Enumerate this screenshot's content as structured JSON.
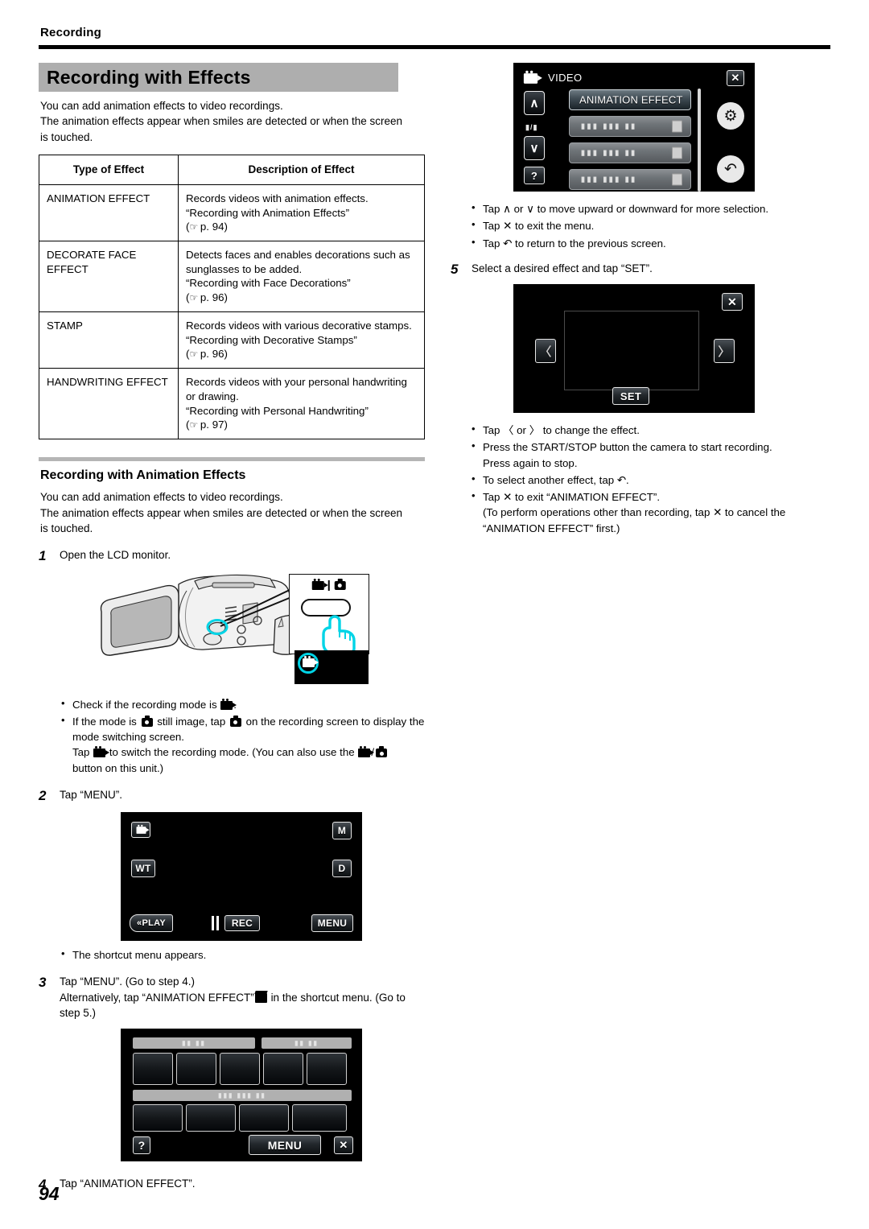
{
  "header": {
    "running_head": "Recording"
  },
  "section": {
    "title": "Recording with Effects",
    "intro_line1": "You can add animation effects to video recordings.",
    "intro_line2": "The animation effects appear when smiles are detected or when the screen",
    "intro_line3": "is touched."
  },
  "table": {
    "columns": [
      "Type of Effect",
      "Description of Effect"
    ],
    "rows": [
      {
        "type": "ANIMATION EFFECT",
        "desc_line1": "Records videos with animation effects.",
        "desc_line2": "“Recording with Animation Effects”",
        "ref": "p. 94"
      },
      {
        "type": "DECORATE FACE EFFECT",
        "desc_line1": "Detects faces and enables decorations such as sunglasses to be added.",
        "desc_line2": "“Recording with Face Decorations”",
        "ref": "p. 96"
      },
      {
        "type": "STAMP",
        "desc_line1": "Records videos with various decorative stamps.",
        "desc_line2": "“Recording with Decorative Stamps”",
        "ref": "p. 96"
      },
      {
        "type": "HANDWRITING EFFECT",
        "desc_line1": "Records videos with your personal handwriting or drawing.",
        "desc_line2": "“Recording with Personal Handwriting”",
        "ref": "p. 97"
      }
    ]
  },
  "subsection": {
    "heading": "Recording with Animation Effects",
    "intro_line1": "You can add animation effects to video recordings.",
    "intro_line2": "The animation effects appear when smiles are detected or when the screen",
    "intro_line3": "is touched."
  },
  "steps": {
    "s1": {
      "num": "1",
      "text": "Open the LCD monitor."
    },
    "s1_bullets": {
      "b1_pre": "Check if the recording mode is",
      "b1_post": ".",
      "b2_pre": "If the mode is",
      "b2_mid1": "still image, tap",
      "b2_mid2": "on the recording screen to display the mode switching screen.",
      "b2_line2_pre": "Tap",
      "b2_line2_mid": "to switch the recording mode. (You can also use the",
      "b2_line2_sep": "/",
      "b2_line2_post": "button on this unit.)"
    },
    "s2": {
      "num": "2",
      "text": "Tap “MENU”."
    },
    "s2_bullet": "The shortcut menu appears.",
    "s3": {
      "num": "3",
      "line1": "Tap “MENU”. (Go to step 4.)",
      "line2_pre": "Alternatively, tap “ANIMATION EFFECT”",
      "line2_post": "in the shortcut menu. (Go to step 5.)"
    },
    "s4": {
      "num": "4",
      "text": "Tap “ANIMATION EFFECT”."
    },
    "s5": {
      "num": "5",
      "text": "Select a desired effect and tap “SET”."
    }
  },
  "right_bullets_top": {
    "b1_pre": "Tap",
    "b1_up": "∧",
    "b1_or": "or",
    "b1_down": "∨",
    "b1_post": "to move upward or downward for more selection.",
    "b2_pre": "Tap",
    "b2_x": "✕",
    "b2_post": "to exit the menu.",
    "b3_pre": "Tap",
    "b3_back": "↶",
    "b3_post": "to return to the previous screen."
  },
  "right_bullets_bottom": {
    "b1_pre": "Tap",
    "b1_left": "〈",
    "b1_or": "or",
    "b1_right": "〉",
    "b1_post": "to change the effect.",
    "b2_line1": "Press the START/STOP button the camera to start recording.",
    "b2_line2": "Press again to stop.",
    "b3_pre": "To select another effect, tap",
    "b3_back": "↶",
    "b3_post": ".",
    "b4_pre": "Tap",
    "b4_x": "✕",
    "b4_post": "to exit “ANIMATION EFFECT”.",
    "b4_line2_pre": "(To perform operations other than recording, tap",
    "b4_line2_x": "✕",
    "b4_line2_post": "to cancel the “ANIMATION EFFECT” first.)"
  },
  "screens": {
    "rec_screen": {
      "mode_icon": "video-mode-icon",
      "m_button": "M",
      "wt_button": "WT",
      "d_button": "D",
      "play_button": "PLAY",
      "rec_button": "REC",
      "menu_button": "MENU"
    },
    "shortcut_screen": {
      "label_1": "▮▮ ▮▮",
      "label_2": "▮▮ ▮▮",
      "label_3": "▮▮▮ ▮▮▮ ▮▮",
      "help_button": "?",
      "menu_button": "MENU",
      "close_button": "✕"
    },
    "video_menu": {
      "title": "VIDEO",
      "close_button": "✕",
      "up_button": "∧",
      "down_button": "∨",
      "page_indicator": "▮/▮",
      "help_button": "?",
      "gear_button": "⚙",
      "back_button": "↶",
      "selected_item": "ANIMATION EFFECT",
      "item_2": "▮▮▮ ▮▮▮ ▮▮",
      "item_3": "▮▮▮ ▮▮▮ ▮▮",
      "item_4": "▮▮▮ ▮▮▮ ▮▮"
    },
    "set_screen": {
      "close_button": "✕",
      "prev_button": "〈",
      "next_button": "〉",
      "set_button": "SET"
    }
  },
  "footer": {
    "page_number": "94"
  }
}
